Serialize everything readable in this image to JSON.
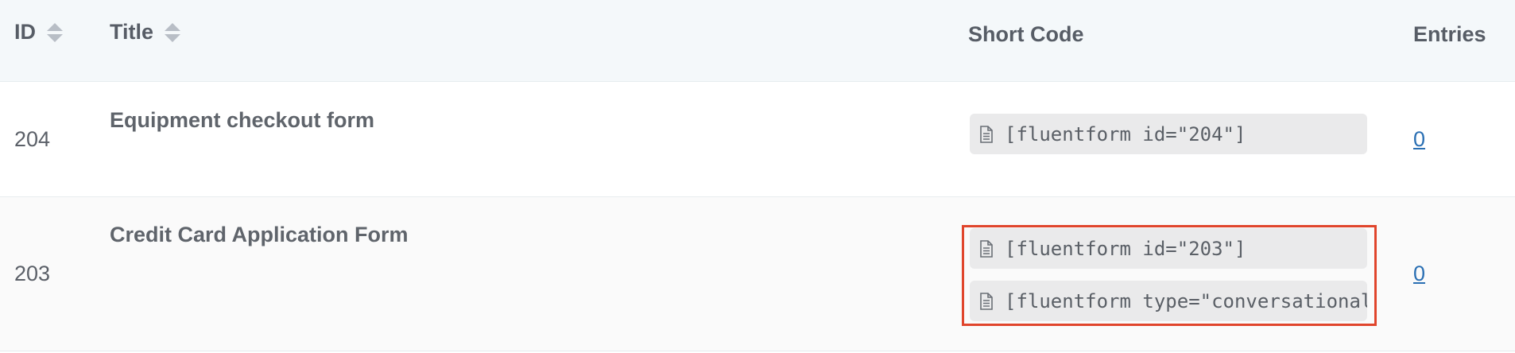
{
  "header": {
    "id_label": "ID",
    "title_label": "Title",
    "shortcode_label": "Short Code",
    "entries_label": "Entries"
  },
  "rows": [
    {
      "id": "204",
      "title": "Equipment checkout form",
      "shortcodes": [
        "[fluentform id=\"204\"]"
      ],
      "entries": "0"
    },
    {
      "id": "203",
      "title": "Credit Card Application Form",
      "shortcodes": [
        "[fluentform id=\"203\"]",
        "[fluentform type=\"conversational\""
      ],
      "entries": "0"
    }
  ],
  "icons": {
    "sort": "sort-icon",
    "document": "document-icon"
  },
  "colors": {
    "header_bg": "#f4f8fa",
    "link": "#2a6fb3",
    "highlight": "#e0452c",
    "shortcode_bg": "#eaeaeb"
  }
}
